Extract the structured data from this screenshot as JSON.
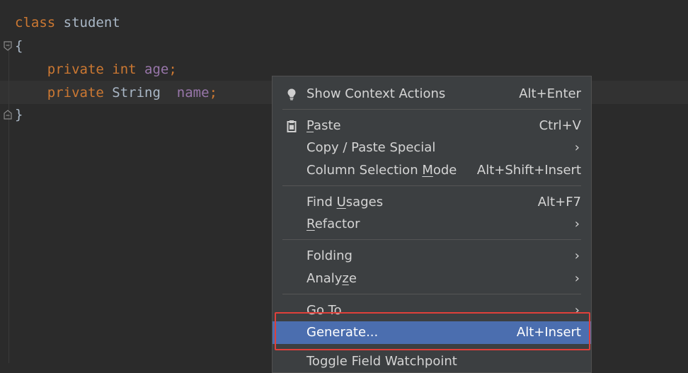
{
  "editor": {
    "lines": [
      {
        "tokens": [
          {
            "t": "class ",
            "c": "kw"
          },
          {
            "t": "student",
            "c": "plain"
          }
        ]
      },
      {
        "tokens": [
          {
            "t": "{",
            "c": "plain"
          }
        ]
      },
      {
        "tokens": [
          {
            "t": "    private ",
            "c": "kw"
          },
          {
            "t": "int ",
            "c": "kw"
          },
          {
            "t": "age",
            "c": "field"
          },
          {
            "t": ";",
            "c": "kw"
          }
        ]
      },
      {
        "tokens": [
          {
            "t": "    private ",
            "c": "kw"
          },
          {
            "t": "String  ",
            "c": "plain"
          },
          {
            "t": "name",
            "c": "field"
          },
          {
            "t": ";",
            "c": "kw"
          }
        ]
      },
      {
        "tokens": [
          {
            "t": "}",
            "c": "plain"
          }
        ]
      }
    ]
  },
  "context_menu": {
    "show_context_actions": {
      "label": "Show Context Actions",
      "shortcut": "Alt+Enter",
      "icon": "lightbulb-icon"
    },
    "paste": {
      "label_pre": "",
      "label_mnemonic": "P",
      "label_post": "aste",
      "shortcut": "Ctrl+V",
      "icon": "clipboard-icon"
    },
    "copy_paste_special": {
      "label": "Copy / Paste Special",
      "submenu": true
    },
    "column_selection_mode": {
      "label_pre": "Column Selection ",
      "label_mnemonic": "M",
      "label_post": "ode",
      "shortcut": "Alt+Shift+Insert"
    },
    "find_usages": {
      "label_pre": "Find ",
      "label_mnemonic": "U",
      "label_post": "sages",
      "shortcut": "Alt+F7"
    },
    "refactor": {
      "label_pre": "",
      "label_mnemonic": "R",
      "label_post": "efactor",
      "submenu": true
    },
    "folding": {
      "label": "Folding",
      "submenu": true
    },
    "analyze": {
      "label_pre": "Analy",
      "label_mnemonic": "z",
      "label_post": "e",
      "submenu": true
    },
    "go_to": {
      "label": "Go To",
      "submenu": true
    },
    "generate": {
      "label": "Generate...",
      "shortcut": "Alt+Insert",
      "selected": true
    },
    "toggle_field_watchpoint": {
      "label": "Toggle Field Watchpoint"
    },
    "chevron": "›"
  },
  "colors": {
    "editor_bg": "#2b2b2b",
    "keyword": "#cc7832",
    "field": "#9876aa",
    "menu_bg": "#3c3f41",
    "selection": "#4b6eaf",
    "annotation_box": "#e0403a"
  }
}
